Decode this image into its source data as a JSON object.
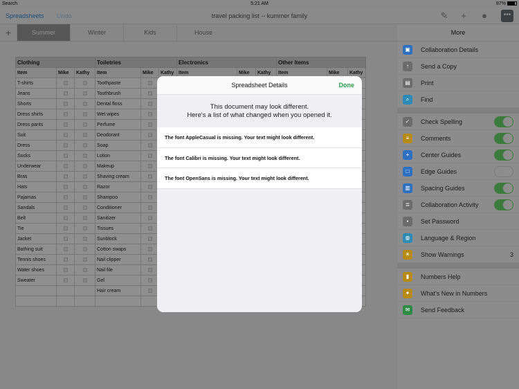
{
  "status": {
    "left": "Search",
    "time": "5:21 AM",
    "battery": "87%"
  },
  "toolbar": {
    "back": "Spreadsheets",
    "undo": "Undo",
    "title": "travel packing list -- kummer family"
  },
  "tabs": [
    "Summer",
    "Winter",
    "Kids",
    "House"
  ],
  "sheet": {
    "groups": [
      "Clothing",
      "Toiletries",
      "Electronics",
      "Other Items"
    ],
    "headers": [
      "Item",
      "Mike",
      "Kathy",
      "Item",
      "Mike",
      "Kathy",
      "Item",
      "Mike",
      "Kathy",
      "Item",
      "Mike",
      "Kathy"
    ],
    "clothing": [
      "T-shirts",
      "Jeans",
      "Shorts",
      "Dress shirts",
      "Dress pants",
      "Suit",
      "Dress",
      "Socks",
      "Underwear",
      "Bras",
      "Hats",
      "Pajamas",
      "Sandals",
      "Belt",
      "Tie",
      "Jacket",
      "Bathing suit",
      "Tennis shoes",
      "Water shoes",
      "Sweater"
    ],
    "toiletries": [
      "Toothpaste",
      "Toothbrush",
      "Dental floss",
      "Wet wipes",
      "Perfume",
      "Deodorant",
      "Soap",
      "Lotion",
      "Makeup",
      "Shaving cream",
      "Razor",
      "Shampoo",
      "Conditioner",
      "Sanitizer",
      "Tissues",
      "Sunblock",
      "Cotton swaps",
      "Nail clipper",
      "Nail file",
      "Gel",
      "Hair cream"
    ]
  },
  "panel": {
    "title": "More",
    "group1": [
      {
        "label": "Collaboration Details",
        "icon": "person-icon",
        "color": "#2f6fc0"
      },
      {
        "label": "Send a Copy",
        "icon": "share-icon",
        "color": "#6b6b6b"
      },
      {
        "label": "Print",
        "icon": "printer-icon",
        "color": "#6b6b6b"
      },
      {
        "label": "Find",
        "icon": "search-icon",
        "color": "#2d8bb6"
      }
    ],
    "group2": [
      {
        "label": "Check Spelling",
        "icon": "spelling-icon",
        "color": "#6b6b6b",
        "toggle": "on"
      },
      {
        "label": "Comments",
        "icon": "comment-icon",
        "color": "#b58a16",
        "toggle": "on"
      },
      {
        "label": "Center Guides",
        "icon": "center-guides-icon",
        "color": "#2f6fc0",
        "toggle": "on"
      },
      {
        "label": "Edge Guides",
        "icon": "edge-guides-icon",
        "color": "#2f6fc0",
        "toggle": "off"
      },
      {
        "label": "Spacing Guides",
        "icon": "spacing-guides-icon",
        "color": "#2f6fc0",
        "toggle": "on"
      },
      {
        "label": "Collaboration Activity",
        "icon": "activity-icon",
        "color": "#6b6b6b",
        "toggle": "on"
      },
      {
        "label": "Set Password",
        "icon": "lock-icon",
        "color": "#6b6b6b"
      },
      {
        "label": "Language & Region",
        "icon": "globe-icon",
        "color": "#2d8bb6"
      },
      {
        "label": "Show Warnings",
        "icon": "warning-icon",
        "color": "#b58a16",
        "value": "3"
      }
    ],
    "group3": [
      {
        "label": "Numbers Help",
        "icon": "book-icon",
        "color": "#b58a16"
      },
      {
        "label": "What's New in Numbers",
        "icon": "sparkle-icon",
        "color": "#b58a16"
      },
      {
        "label": "Send Feedback",
        "icon": "feedback-icon",
        "color": "#2e8a45"
      }
    ]
  },
  "modal": {
    "title": "Spreadsheet Details",
    "done": "Done",
    "intro_line1": "This document may look different.",
    "intro_line2": "Here's a list of what changed when you opened it.",
    "items": [
      "The font AppleCasual is missing. Your text might look different.",
      "The font Calibri is missing. Your text might look different.",
      "The font OpenSans is missing. Your text might look different."
    ]
  }
}
